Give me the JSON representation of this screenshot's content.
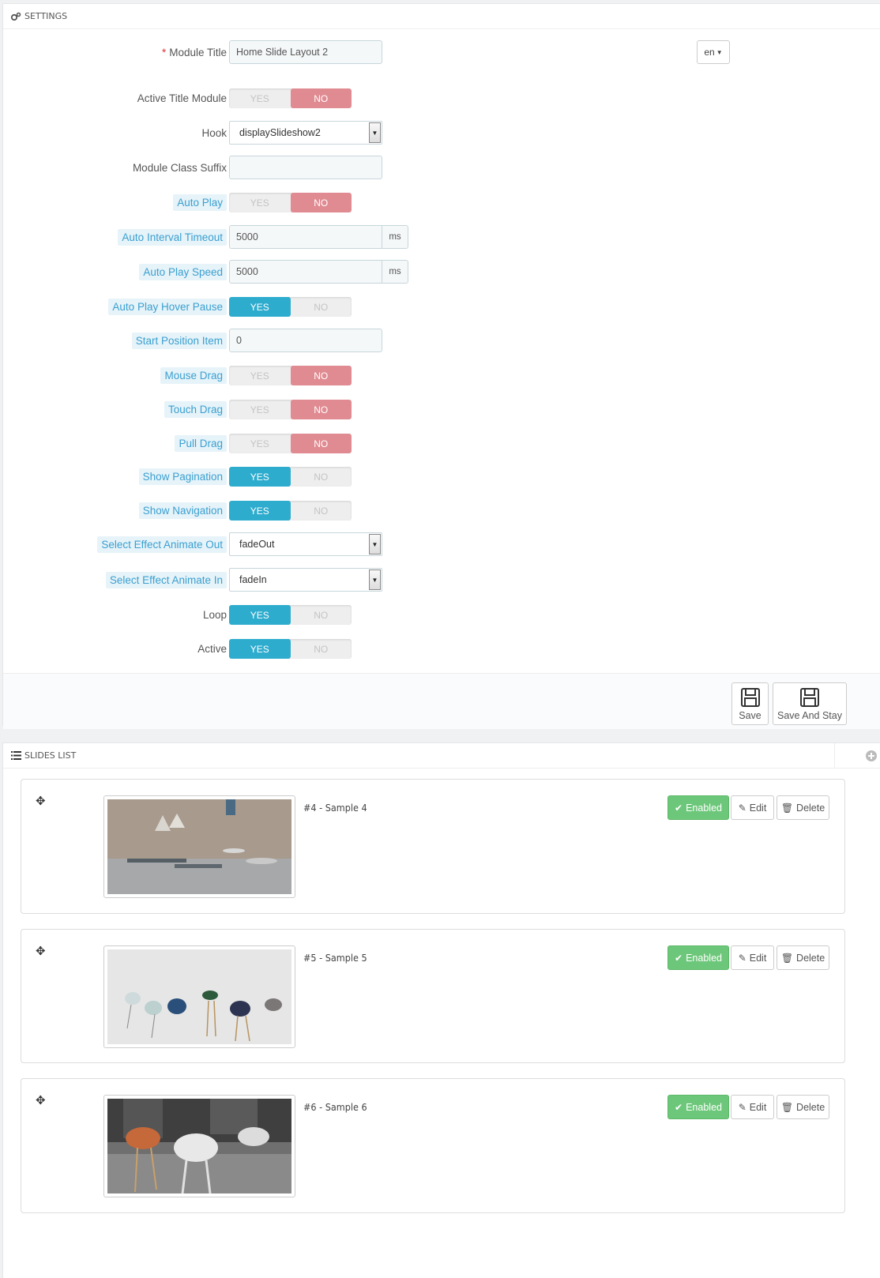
{
  "settings_panel": {
    "title": "SETTINGS",
    "lang": "en",
    "fields": {
      "module_title": {
        "label": "Module Title",
        "value": "Home Slide Layout 2"
      },
      "active_title_module": {
        "label": "Active Title Module",
        "yes": "YES",
        "no": "NO",
        "value": "NO"
      },
      "hook": {
        "label": "Hook",
        "value": "displaySlideshow2"
      },
      "module_class_suffix": {
        "label": "Module Class Suffix",
        "value": ""
      },
      "auto_play": {
        "label": "Auto Play",
        "yes": "YES",
        "no": "NO",
        "value": "NO"
      },
      "auto_interval_timeout": {
        "label": "Auto Interval Timeout",
        "value": "5000",
        "unit": "ms"
      },
      "auto_play_speed": {
        "label": "Auto Play Speed",
        "value": "5000",
        "unit": "ms"
      },
      "auto_play_hover_pause": {
        "label": "Auto Play Hover Pause",
        "yes": "YES",
        "no": "NO",
        "value": "YES"
      },
      "start_position_item": {
        "label": "Start Position Item",
        "value": "0"
      },
      "mouse_drag": {
        "label": "Mouse Drag",
        "yes": "YES",
        "no": "NO",
        "value": "NO"
      },
      "touch_drag": {
        "label": "Touch Drag",
        "yes": "YES",
        "no": "NO",
        "value": "NO"
      },
      "pull_drag": {
        "label": "Pull Drag",
        "yes": "YES",
        "no": "NO",
        "value": "NO"
      },
      "show_pagination": {
        "label": "Show Pagination",
        "yes": "YES",
        "no": "NO",
        "value": "YES"
      },
      "show_navigation": {
        "label": "Show Navigation",
        "yes": "YES",
        "no": "NO",
        "value": "YES"
      },
      "select_effect_animate_out": {
        "label": "Select Effect Animate Out",
        "value": "fadeOut"
      },
      "select_effect_animate_in": {
        "label": "Select Effect Animate In",
        "value": "fadeIn"
      },
      "loop": {
        "label": "Loop",
        "yes": "YES",
        "no": "NO",
        "value": "YES"
      },
      "active": {
        "label": "Active",
        "yes": "YES",
        "no": "NO",
        "value": "YES"
      }
    },
    "save_label": "Save",
    "save_and_stay_label": "Save And Stay"
  },
  "slides_panel": {
    "title": "SLIDES LIST",
    "slides": [
      {
        "title": "#4 - Sample 4",
        "enabled_label": "Enabled",
        "edit_label": "Edit",
        "delete_label": "Delete"
      },
      {
        "title": "#5 - Sample 5",
        "enabled_label": "Enabled",
        "edit_label": "Edit",
        "delete_label": "Delete"
      },
      {
        "title": "#6 - Sample 6",
        "enabled_label": "Enabled",
        "edit_label": "Edit",
        "delete_label": "Delete"
      }
    ]
  },
  "colors": {
    "switch_yes": "#2eacce",
    "switch_no": "#e08b92",
    "enabled_green": "#6dc77a",
    "help_label": "#3a9fd0"
  }
}
